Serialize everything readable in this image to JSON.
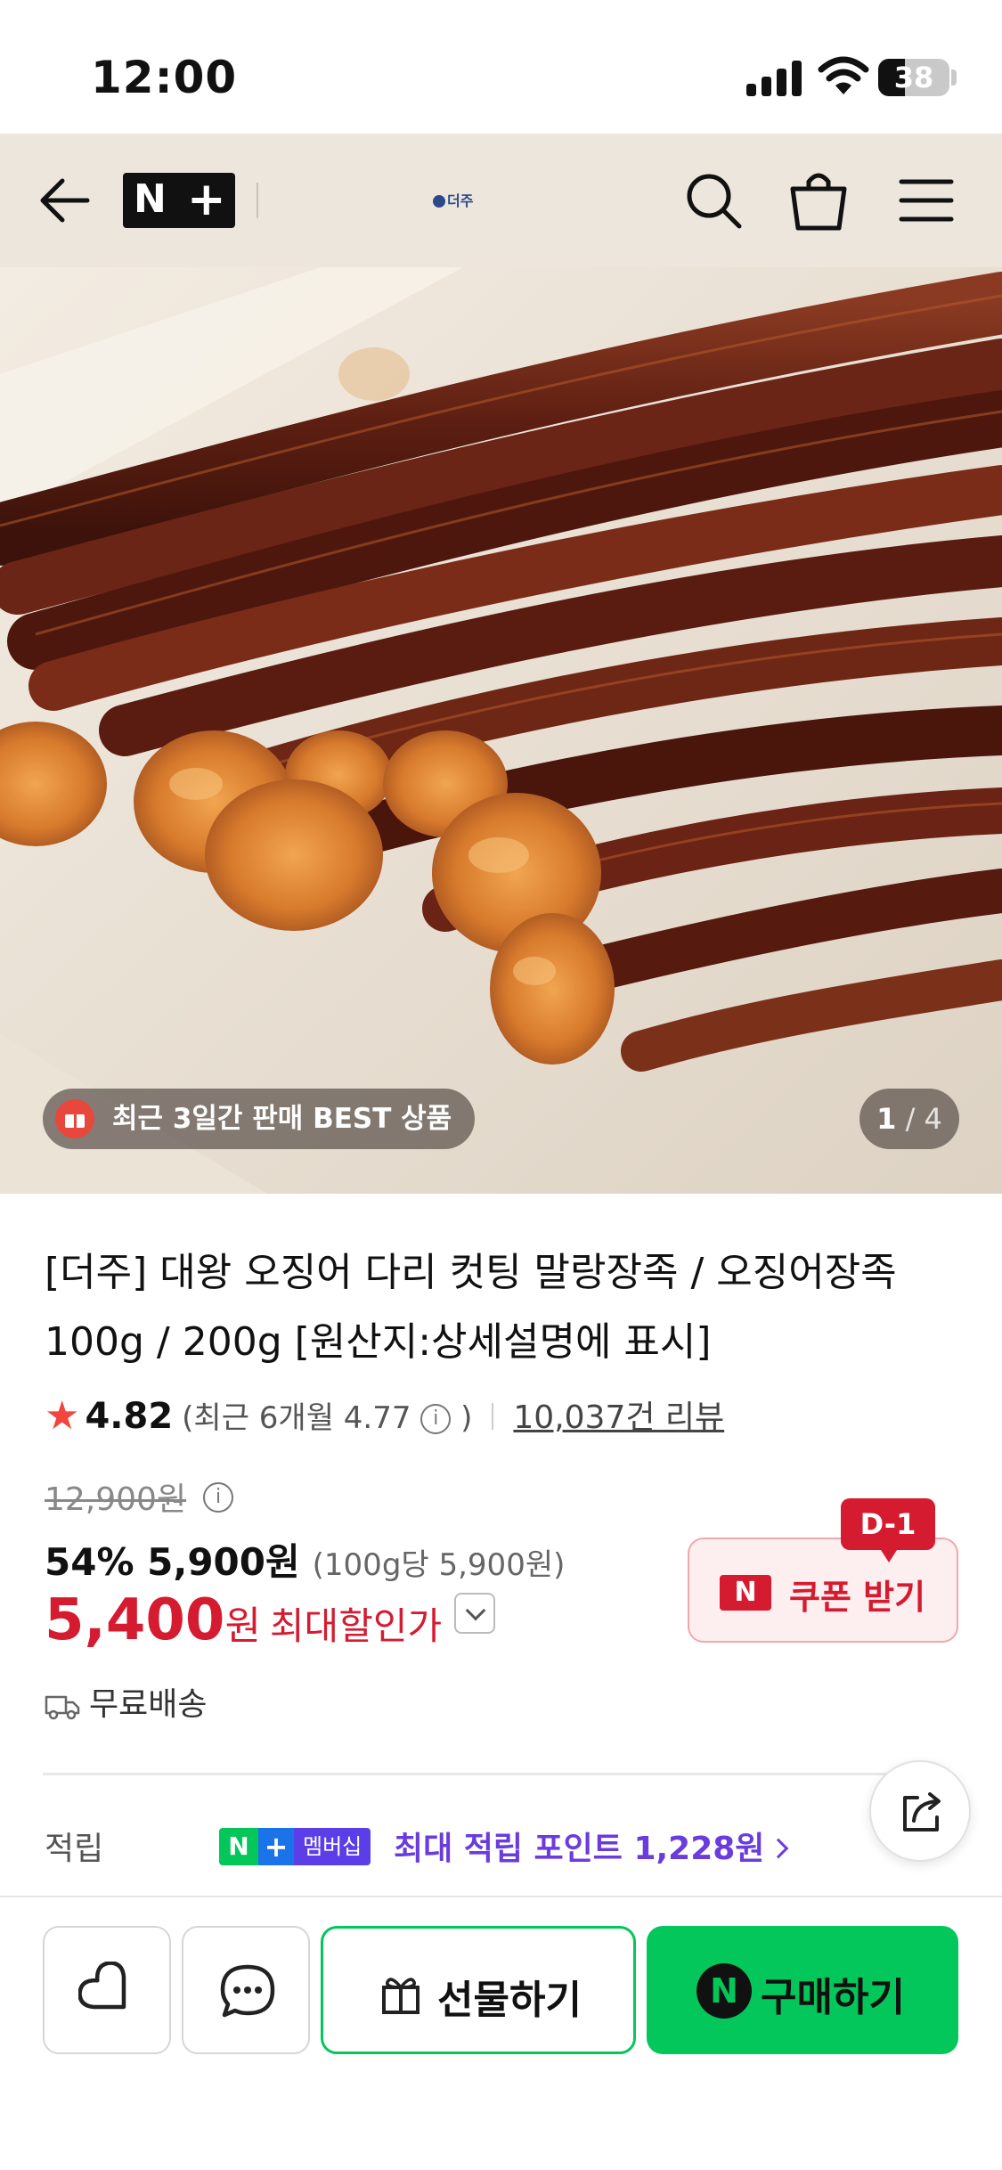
{
  "status_bar": {
    "time": "12:00",
    "battery": "38",
    "battery_level": 0.38
  },
  "nav": {
    "store_logo": "더주"
  },
  "hero": {
    "badge_text": "최근 3일간 판매 BEST 상품",
    "page_current": "1",
    "page_total": "/ 4"
  },
  "product": {
    "title": "[더주] 대왕 오징어 다리 컷팅 말랑장족 / 오징어장족 100g / 200g [원산지:상세설명에 표시]",
    "rating": "4.82",
    "rating_recent_prefix": "(최근 6개월 4.77",
    "rating_recent_suffix": ")",
    "review_count": "10,037건 리뷰",
    "original_price": "12,900원",
    "discount": "54%",
    "sale_price": "5,900원",
    "unit_price": "(100g당 5,900원)",
    "max_price": "5,400",
    "max_won": "원",
    "max_label": "최대할인가",
    "coupon_label": "쿠폰 받기",
    "coupon_n": "N",
    "dday": "D-1",
    "shipping": "무료배송"
  },
  "points": {
    "label": "적립",
    "badge_n": "N",
    "badge_plus": "+",
    "badge_text": "멤버십",
    "text": "최대 적립 포인트 1,228원"
  },
  "actions": {
    "gift_label": "선물하기",
    "buy_label": "구매하기",
    "buy_n": "N"
  },
  "colors": {
    "nav_bg": "#ede6dc",
    "accent_red": "#d51b30",
    "naver_green": "#03c75a",
    "membership_purple": "#6a3cde"
  }
}
